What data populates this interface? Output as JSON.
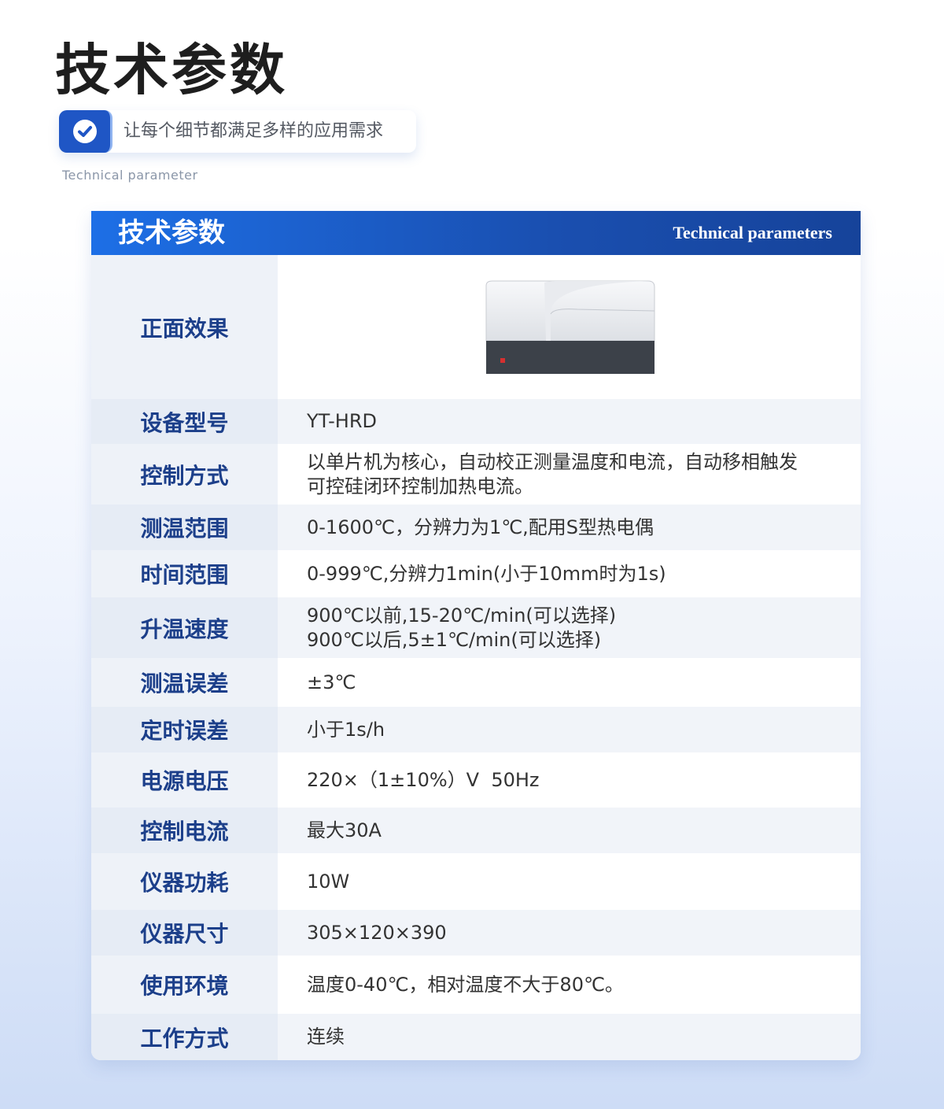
{
  "header": {
    "title": "技术参数",
    "subtitle": "让每个细节都满足多样的应用需求",
    "english_subtitle": "Technical parameter"
  },
  "card": {
    "title": "技术参数",
    "english_title": "Technical parameters",
    "rows": [
      {
        "label": "正面效果",
        "value": ""
      },
      {
        "label": "设备型号",
        "value": "YT-HRD"
      },
      {
        "label": "控制方式",
        "value": "以单片机为核心，自动校正测量温度和电流，自动移相触发",
        "value2": "可控硅闭环控制加热电流。"
      },
      {
        "label": "测温范围",
        "value": "0-1600℃，分辨力为1℃,配用S型热电偶"
      },
      {
        "label": "时间范围",
        "value": "0-999℃,分辨力1min(小于10mm时为1s)"
      },
      {
        "label": "升温速度",
        "value": "900℃以前,15-20℃/min(可以选择)",
        "value2": "900℃以后,5±1℃/min(可以选择)"
      },
      {
        "label": "测温误差",
        "value": "±3℃"
      },
      {
        "label": "定时误差",
        "value": "小于1s/h"
      },
      {
        "label": "电源电压",
        "value": "220×（1±10%）V  50Hz"
      },
      {
        "label": "控制电流",
        "value": "最大30A"
      },
      {
        "label": "仪器功耗",
        "value": "10W"
      },
      {
        "label": "仪器尺寸",
        "value": "305×120×390"
      },
      {
        "label": "使用环境",
        "value": "温度0-40℃，相对温度不大于80℃。"
      },
      {
        "label": "工作方式",
        "value": "连续"
      }
    ]
  },
  "colors": {
    "accent": "#1f56c5",
    "label_text": "#1c3f8a",
    "header_gradient_start": "#1d6fe6",
    "header_gradient_end": "#16439a"
  },
  "icons": {
    "subtitle": "check-icon"
  }
}
